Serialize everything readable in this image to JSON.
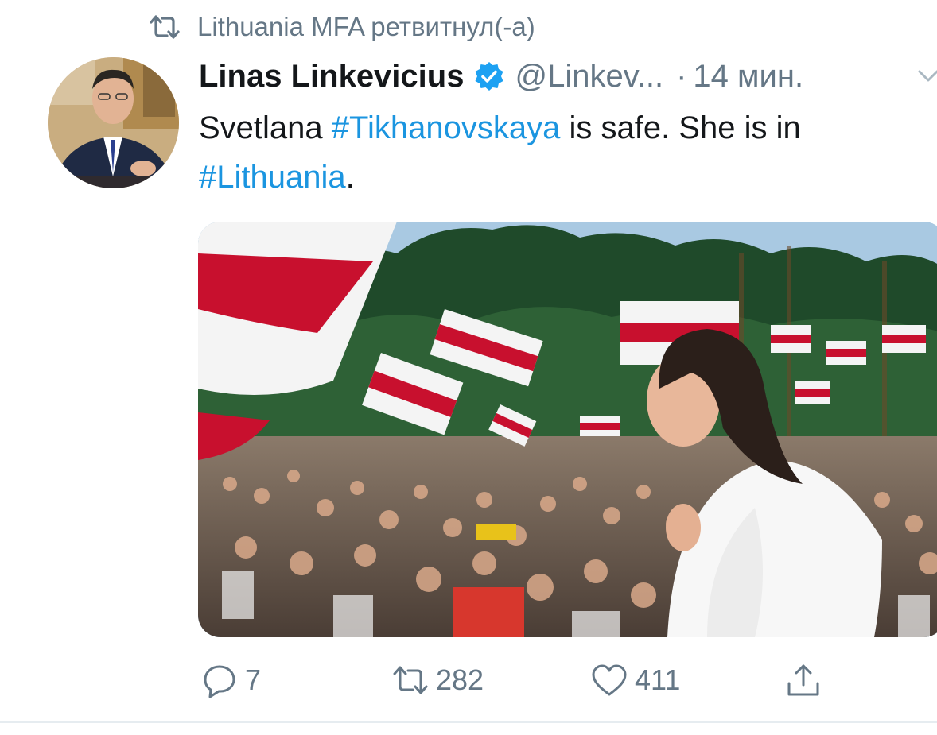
{
  "retweet": {
    "label": "Lithuania MFA ретвитнул(-а)",
    "icon": "retweet-icon"
  },
  "tweet": {
    "author_name": "Linas Linkevicius",
    "verified": true,
    "handle": "@Linkev...",
    "separator": "·",
    "timestamp": "14 мин.",
    "text_parts": {
      "p1": "Svetlana ",
      "tag1": "#Tikhanovskaya",
      "p2": " is safe. She is in ",
      "tag2": "#Lithuania",
      "p3": "."
    },
    "media_icon": "photo-image"
  },
  "actions": {
    "reply_count": "7",
    "retweet_count": "282",
    "like_count": "411"
  },
  "colors": {
    "hashtag": "#1b95e0",
    "muted": "#657786",
    "verified": "#1da1f2",
    "flag_red": "#c8102e"
  }
}
